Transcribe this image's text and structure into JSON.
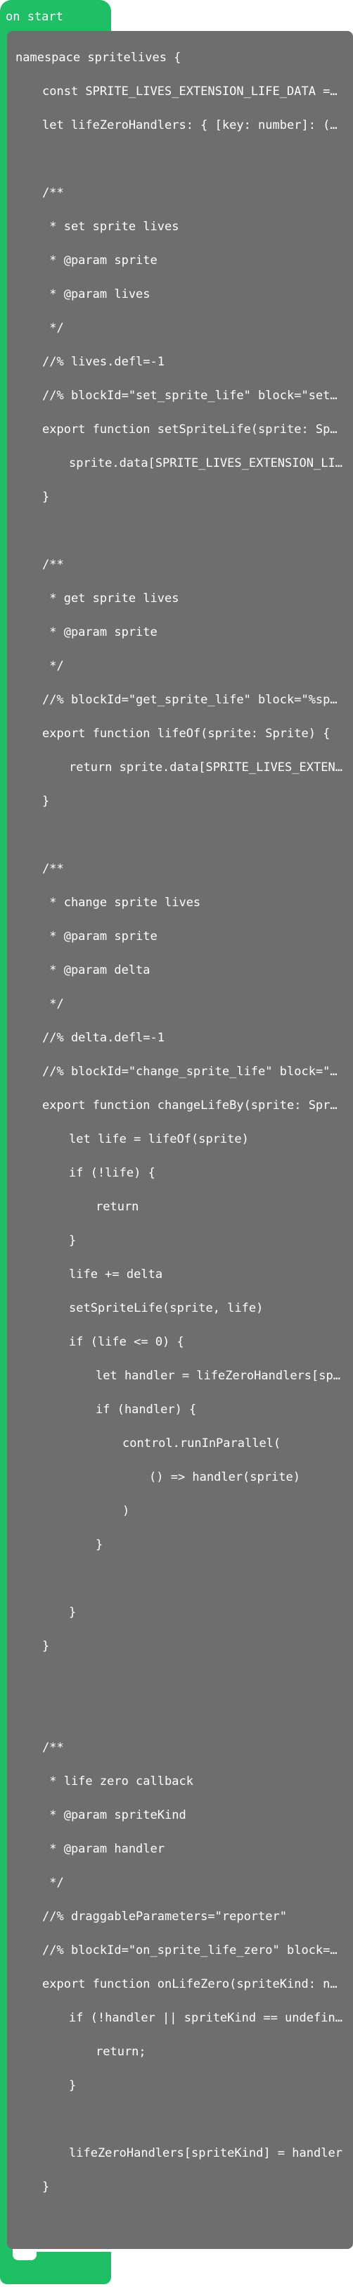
{
  "hat": {
    "label": "on start"
  },
  "colors": {
    "event_green": "#1fbf66",
    "code_gray": "#6e6e6e",
    "text": "#ffffff"
  },
  "code": {
    "lines": [
      {
        "indent": 0,
        "text": "namespace spritelives {"
      },
      {
        "indent": 1,
        "text": "const SPRITE_LIVES_EXTENSION_LIFE_DATA = \"SPRITE_LIVES_EXTENSION_LIFE_DATA\""
      },
      {
        "indent": 1,
        "text": "let lifeZeroHandlers: { [key: number]: (sprite: Sprite) => void } = {}"
      },
      {
        "indent": 1,
        "text": ""
      },
      {
        "indent": 1,
        "text": "/**"
      },
      {
        "indent": 1,
        "text": " * set sprite lives"
      },
      {
        "indent": 1,
        "text": " * @param sprite"
      },
      {
        "indent": 1,
        "text": " * @param lives"
      },
      {
        "indent": 1,
        "text": " */"
      },
      {
        "indent": 1,
        "text": "//% lives.defl=-1"
      },
      {
        "indent": 1,
        "text": "//% blockId=\"set_sprite_life\" block=\"set %sprite life to %lives\""
      },
      {
        "indent": 1,
        "text": "export function setSpriteLife(sprite: Sprite, lives: number) {"
      },
      {
        "indent": 2,
        "text": "sprite.data[SPRITE_LIVES_EXTENSION_LIFE_DATA] = lives"
      },
      {
        "indent": 1,
        "text": "}"
      },
      {
        "indent": 1,
        "text": ""
      },
      {
        "indent": 1,
        "text": "/**"
      },
      {
        "indent": 1,
        "text": " * get sprite lives"
      },
      {
        "indent": 1,
        "text": " * @param sprite"
      },
      {
        "indent": 1,
        "text": " */"
      },
      {
        "indent": 1,
        "text": "//% blockId=\"get_sprite_life\" block=\"%sprite life\""
      },
      {
        "indent": 1,
        "text": "export function lifeOf(sprite: Sprite) {"
      },
      {
        "indent": 2,
        "text": "return sprite.data[SPRITE_LIVES_EXTENSION_LIFE_DATA]"
      },
      {
        "indent": 1,
        "text": "}"
      },
      {
        "indent": 1,
        "text": ""
      },
      {
        "indent": 1,
        "text": "/**"
      },
      {
        "indent": 1,
        "text": " * change sprite lives"
      },
      {
        "indent": 1,
        "text": " * @param sprite"
      },
      {
        "indent": 1,
        "text": " * @param delta"
      },
      {
        "indent": 1,
        "text": " */"
      },
      {
        "indent": 1,
        "text": "//% delta.defl=-1"
      },
      {
        "indent": 1,
        "text": "//% blockId=\"change_sprite_life\" block=\"change %sprite life by %delta\""
      },
      {
        "indent": 1,
        "text": "export function changeLifeBy(sprite: Sprite, delta: number) {"
      },
      {
        "indent": 2,
        "text": "let life = lifeOf(sprite)"
      },
      {
        "indent": 2,
        "text": "if (!life) {"
      },
      {
        "indent": 3,
        "text": "return"
      },
      {
        "indent": 2,
        "text": "}"
      },
      {
        "indent": 2,
        "text": "life += delta"
      },
      {
        "indent": 2,
        "text": "setSpriteLife(sprite, life)"
      },
      {
        "indent": 2,
        "text": "if (life <= 0) {"
      },
      {
        "indent": 3,
        "text": "let handler = lifeZeroHandlers[sprite.kind()]"
      },
      {
        "indent": 3,
        "text": "if (handler) {"
      },
      {
        "indent": 4,
        "text": "control.runInParallel("
      },
      {
        "indent": 5,
        "text": "() => handler(sprite)"
      },
      {
        "indent": 4,
        "text": ")"
      },
      {
        "indent": 3,
        "text": "}"
      },
      {
        "indent": 3,
        "text": ""
      },
      {
        "indent": 2,
        "text": "}"
      },
      {
        "indent": 1,
        "text": "}"
      },
      {
        "indent": 1,
        "text": ""
      },
      {
        "indent": 1,
        "text": ""
      },
      {
        "indent": 1,
        "text": "/**"
      },
      {
        "indent": 1,
        "text": " * life zero callback"
      },
      {
        "indent": 1,
        "text": " * @param spriteKind"
      },
      {
        "indent": 1,
        "text": " * @param handler"
      },
      {
        "indent": 1,
        "text": " */"
      },
      {
        "indent": 1,
        "text": "//% draggableParameters=\"reporter\""
      },
      {
        "indent": 1,
        "text": "//% blockId=\"on_sprite_life_zero\" block=\"on %spriteKind life zero\""
      },
      {
        "indent": 1,
        "text": "export function onLifeZero(spriteKind: number, handler: (sprite: Sprite) => void) {"
      },
      {
        "indent": 2,
        "text": "if (!handler || spriteKind == undefined) {"
      },
      {
        "indent": 3,
        "text": "return;"
      },
      {
        "indent": 2,
        "text": "}"
      },
      {
        "indent": 2,
        "text": ""
      },
      {
        "indent": 2,
        "text": "lifeZeroHandlers[spriteKind] = handler"
      },
      {
        "indent": 1,
        "text": "}"
      },
      {
        "indent": 1,
        "text": ""
      },
      {
        "indent": 0,
        "text": "}"
      }
    ]
  }
}
